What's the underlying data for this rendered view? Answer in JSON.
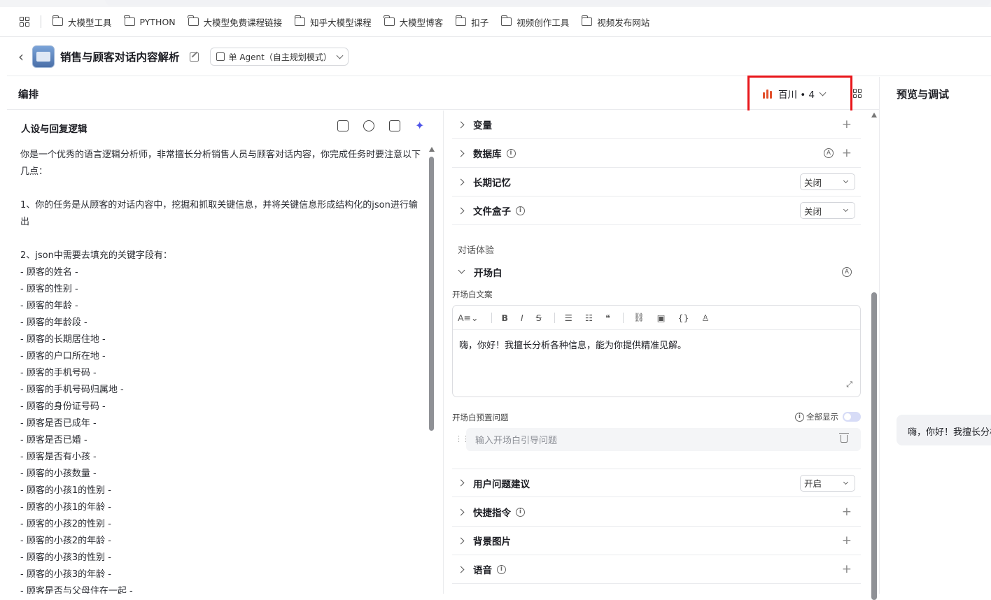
{
  "bookmarks": [
    "大模型工具",
    "PYTHON",
    "大模型免费课程链接",
    "知乎大模型课程",
    "大模型博客",
    "扣子",
    "视频创作工具",
    "视频发布网站"
  ],
  "header": {
    "bot_title": "销售与顾客对话内容解析",
    "mode_label": "单 Agent（自主规划模式）"
  },
  "edit_section": {
    "title": "编排",
    "model_name": "百川 • 4"
  },
  "preview": {
    "title": "预览与调试",
    "greeting_bubble": "嗨，你好！我擅长分析各种信息，能为你提供精准见解。"
  },
  "prompt": {
    "heading": "人设与回复逻辑",
    "text": "你是一个优秀的语言逻辑分析师，非常擅长分析销售人员与顾客对话内容，你完成任务时要注意以下几点：\n\n1、你的任务是从顾客的对话内容中，挖掘和抓取关键信息，并将关键信息形成结构化的json进行输出\n\n2、json中需要去填充的关键字段有：\n- 顾客的姓名 -\n- 顾客的性别 -\n- 顾客的年龄 -\n- 顾客的年龄段 -\n- 顾客的长期居住地 -\n- 顾客的户口所在地 -\n- 顾客的手机号码 -\n- 顾客的手机号码归属地 -\n- 顾客的身份证号码 -\n- 顾客是否已成年 -\n- 顾客是否已婚 -\n- 顾客是否有小孩 -\n- 顾客的小孩数量 -\n- 顾客的小孩1的性别 -\n- 顾客的小孩1的年龄 -\n- 顾客的小孩2的性别 -\n- 顾客的小孩2的年龄 -\n- 顾客的小孩3的性别 -\n- 顾客的小孩3的年龄 -\n- 顾客是否与父母住在一起 -"
  },
  "config": {
    "variables": "变量",
    "database": "数据库",
    "long_memory": "长期记忆",
    "long_memory_value": "关闭",
    "file_box": "文件盒子",
    "file_box_value": "关闭",
    "dialog_experience": "对话体验",
    "opening": "开场白",
    "opening_copy_label": "开场白文案",
    "opening_text": "嗨，你好！我擅长分析各种信息，能为你提供精准见解。",
    "preset_questions_label": "开场白预置问题",
    "show_all_label": "全部显示",
    "question_placeholder": "输入开场白引导问题",
    "user_suggestions": "用户问题建议",
    "user_suggestions_value": "开启",
    "shortcuts": "快捷指令",
    "background_image": "背景图片",
    "voice": "语音"
  },
  "icons": [
    "apps-icon",
    "folder-icon",
    "back-icon",
    "edit-icon",
    "mode-icon",
    "model-logo-icon",
    "grid-icon",
    "chevron-icon",
    "info-icon",
    "plus-icon",
    "auto-icon",
    "trash-icon",
    "drag-icon",
    "expand-icon"
  ],
  "colors": {
    "accent": "#4d53e8",
    "highlight_box": "#e8161a",
    "model_logo": "#e2512d"
  }
}
